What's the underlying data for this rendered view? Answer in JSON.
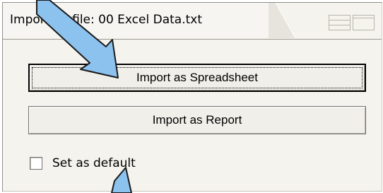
{
  "window": {
    "title": "Importing file: 00 Excel Data.txt"
  },
  "buttons": {
    "import_spreadsheet": "Import as Spreadsheet",
    "import_report": "Import as Report"
  },
  "checkbox": {
    "label": "Set as default",
    "checked": false
  },
  "icons": {
    "window_controls": [
      "tile-horizontal-icon",
      "tile-vertical-icon"
    ],
    "annotation_arrows": [
      "arrow-pointer-icon",
      "arrow-pointer-icon"
    ]
  },
  "colors": {
    "arrow_fill": "#8cc2ee",
    "arrow_outline": "#1a1a1a",
    "panel_bg": "#f4f3ee"
  }
}
